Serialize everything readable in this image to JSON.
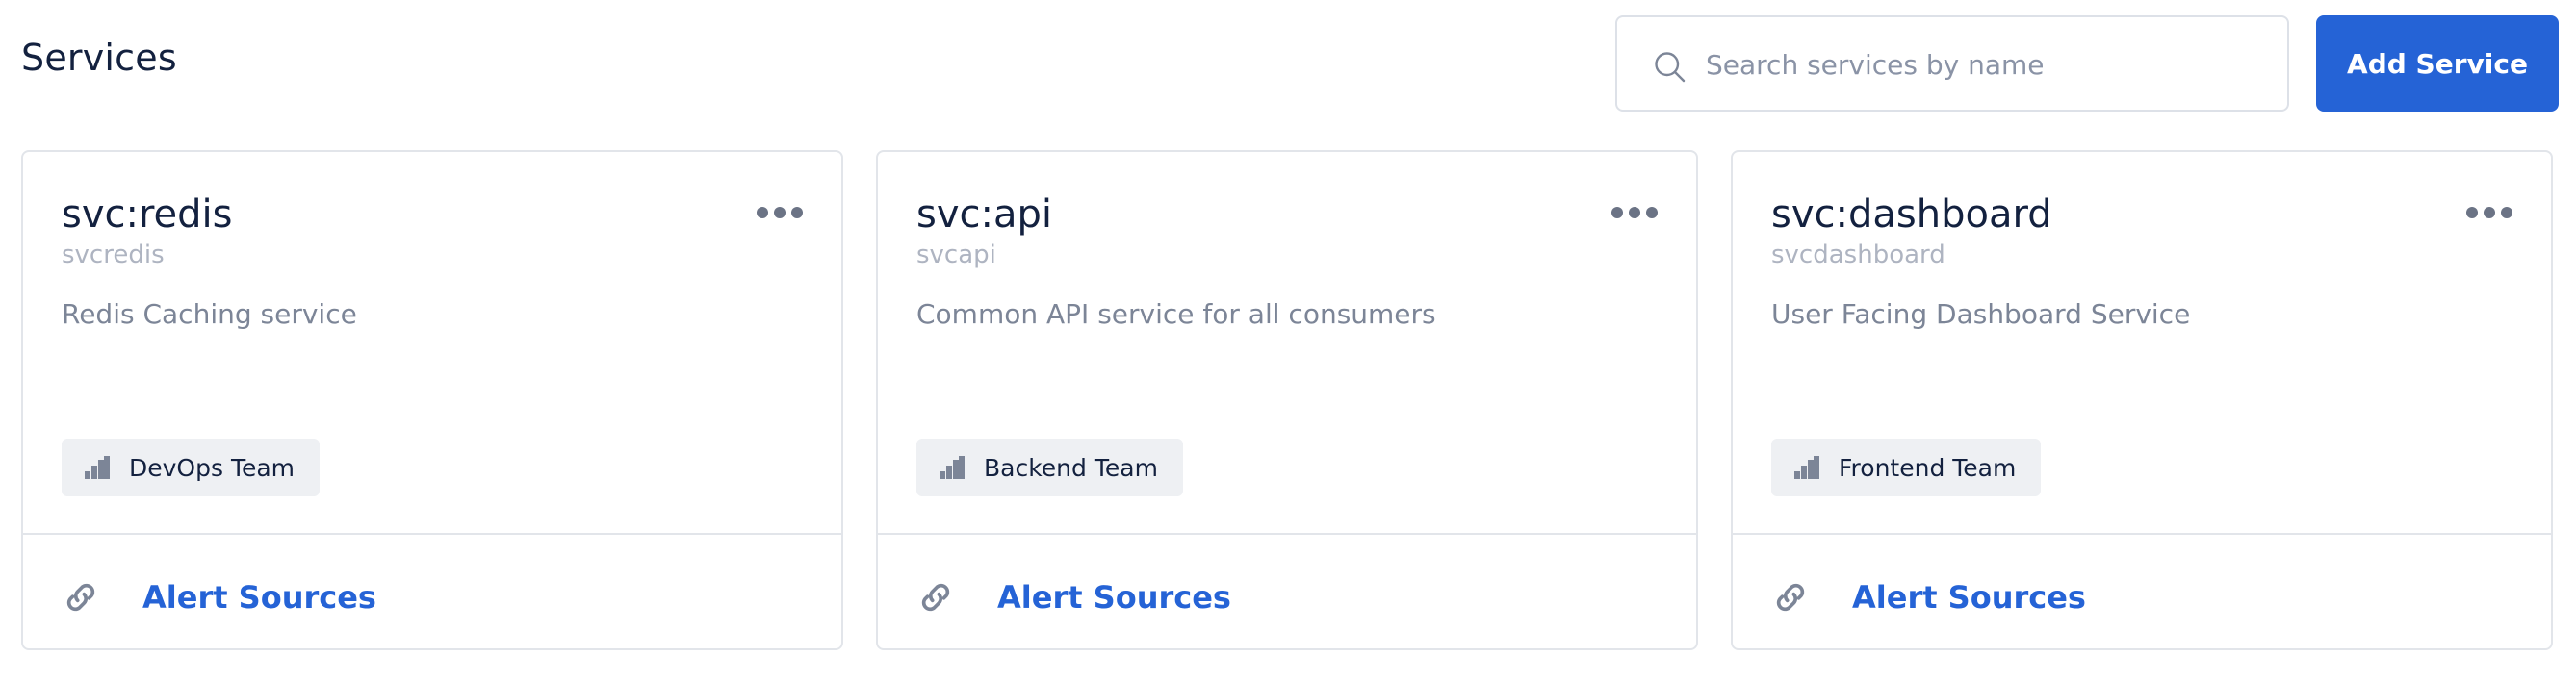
{
  "page": {
    "title": "Services"
  },
  "search": {
    "placeholder": "Search services by name",
    "value": ""
  },
  "toolbar": {
    "add_label": "Add Service"
  },
  "colors": {
    "accent": "#2563d6",
    "badge_bg": "#eef0f3",
    "border": "#e2e5ea"
  },
  "cards": [
    {
      "name": "svc:redis",
      "id": "svcredis",
      "description": "Redis Caching service",
      "team": "DevOps Team",
      "alert_label": "Alert Sources"
    },
    {
      "name": "svc:api",
      "id": "svcapi",
      "description": "Common API service for all consumers",
      "team": "Backend Team",
      "alert_label": "Alert Sources"
    },
    {
      "name": "svc:dashboard",
      "id": "svcdashboard",
      "description": "User Facing Dashboard Service",
      "team": "Frontend Team",
      "alert_label": "Alert Sources"
    }
  ],
  "icons": {
    "search": "search-icon",
    "more": "more-horizontal-icon",
    "team": "team-icon",
    "alerts": "link-icon"
  }
}
